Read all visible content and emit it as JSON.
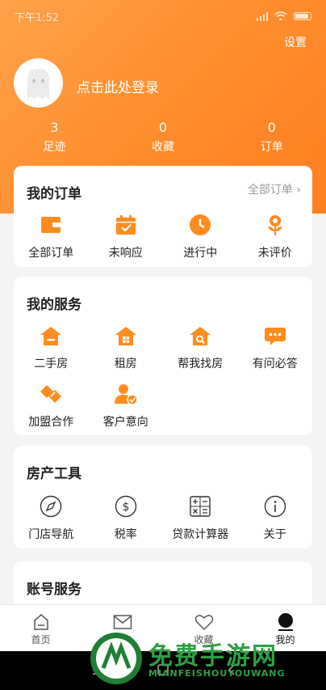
{
  "status": {
    "time": "下午1:52"
  },
  "header": {
    "settings_label": "设置",
    "login_label": "点击此处登录"
  },
  "stats": [
    {
      "num": "3",
      "label": "足迹"
    },
    {
      "num": "0",
      "label": "收藏"
    },
    {
      "num": "0",
      "label": "订单"
    }
  ],
  "orders": {
    "title": "我的订单",
    "link": "全部订单 ›",
    "items": [
      {
        "label": "全部订单",
        "icon": "wallet-icon"
      },
      {
        "label": "未响应",
        "icon": "calendar-check-icon"
      },
      {
        "label": "进行中",
        "icon": "clock-icon"
      },
      {
        "label": "未评价",
        "icon": "flower-icon"
      }
    ]
  },
  "services": {
    "title": "我的服务",
    "row1": [
      {
        "label": "二手房",
        "icon": "house-minus-icon"
      },
      {
        "label": "租房",
        "icon": "house-grid-icon"
      },
      {
        "label": "帮我找房",
        "icon": "house-search-icon"
      },
      {
        "label": "有问必答",
        "icon": "chat-bubble-icon"
      }
    ],
    "row2": [
      {
        "label": "加盟合作",
        "icon": "handshake-icon"
      },
      {
        "label": "客户意向",
        "icon": "user-check-icon"
      }
    ]
  },
  "tools": {
    "title": "房产工具",
    "items": [
      {
        "label": "门店导航",
        "icon": "compass-icon"
      },
      {
        "label": "税率",
        "icon": "dollar-circle-icon"
      },
      {
        "label": "贷款计算器",
        "icon": "calculator-icon"
      },
      {
        "label": "关于",
        "icon": "info-icon"
      }
    ]
  },
  "account": {
    "title": "账号服务"
  },
  "tabbar": [
    {
      "label": "首页",
      "icon": "home-icon"
    },
    {
      "label": "消息",
      "icon": "mail-icon"
    },
    {
      "label": "收藏",
      "icon": "heart-icon"
    },
    {
      "label": "我的",
      "icon": "user-icon"
    }
  ],
  "watermark": {
    "text": "免费手游网",
    "sub": "MIANFEISHOUYOUWANG"
  },
  "colors": {
    "accent": "#ff8c2b",
    "icon_orange": "#ff8c1e",
    "watermark_green": "#2fa043"
  }
}
